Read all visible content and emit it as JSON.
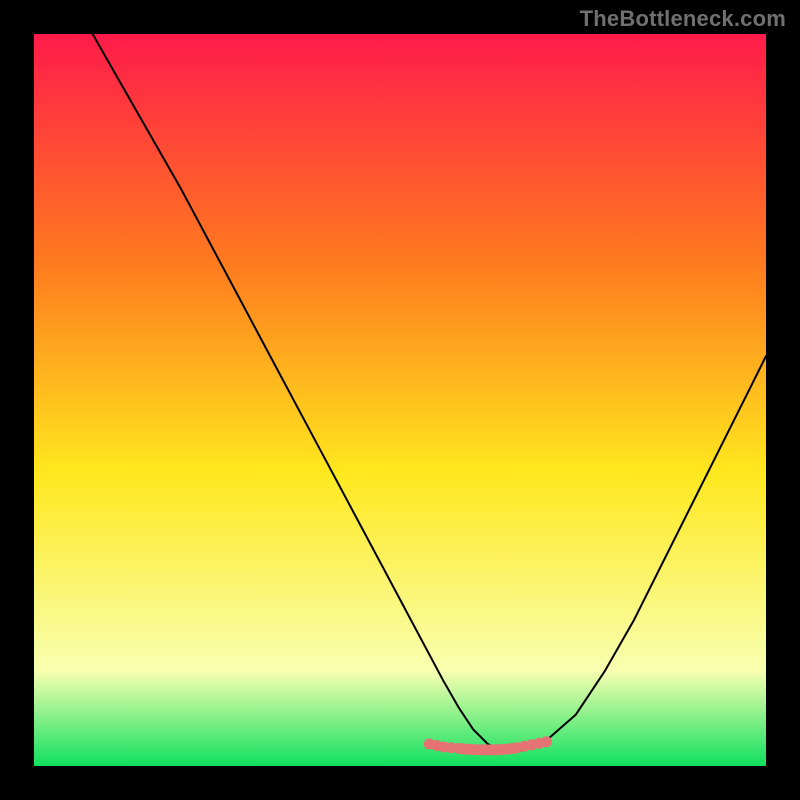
{
  "watermark": "TheBottleneck.com",
  "colors": {
    "page_bg": "#000000",
    "grad_top": "#ff1b4a",
    "grad_mid1": "#ff7d1e",
    "grad_mid2": "#ffe81e",
    "grad_low": "#f8ffb0",
    "grad_bottom": "#0fe060",
    "curve": "#000000",
    "marker": "#e57373"
  },
  "chart_data": {
    "type": "line",
    "title": "",
    "xlabel": "",
    "ylabel": "",
    "xlim": [
      0,
      100
    ],
    "ylim": [
      0,
      100
    ],
    "background": "rainbow-gradient",
    "series": [
      {
        "name": "curve",
        "x": [
          8,
          12,
          16,
          20,
          24,
          28,
          32,
          36,
          40,
          44,
          48,
          52,
          56,
          58,
          60,
          62,
          64,
          66,
          68,
          70,
          74,
          78,
          82,
          86,
          90,
          94,
          98,
          100
        ],
        "y": [
          100,
          93,
          86,
          79,
          71.5,
          64,
          56.5,
          49,
          41.5,
          34,
          26.5,
          19,
          11.5,
          8,
          5,
          3,
          2,
          2,
          2.5,
          3.5,
          7,
          13,
          20,
          28,
          36,
          44,
          52,
          56
        ]
      }
    ],
    "markers": {
      "name": "bottom-markers",
      "x": [
        54,
        55,
        56,
        57,
        58,
        58.5,
        59,
        59.5,
        60,
        60.5,
        61,
        61.5,
        62,
        62.5,
        63,
        63.5,
        64,
        64.5,
        65,
        65.5,
        66,
        67,
        68,
        69,
        70
      ],
      "y": [
        3.0,
        2.8,
        2.6,
        2.5,
        2.4,
        2.35,
        2.3,
        2.28,
        2.25,
        2.23,
        2.22,
        2.21,
        2.2,
        2.21,
        2.22,
        2.24,
        2.27,
        2.3,
        2.35,
        2.4,
        2.5,
        2.7,
        2.9,
        3.1,
        3.3
      ]
    }
  }
}
